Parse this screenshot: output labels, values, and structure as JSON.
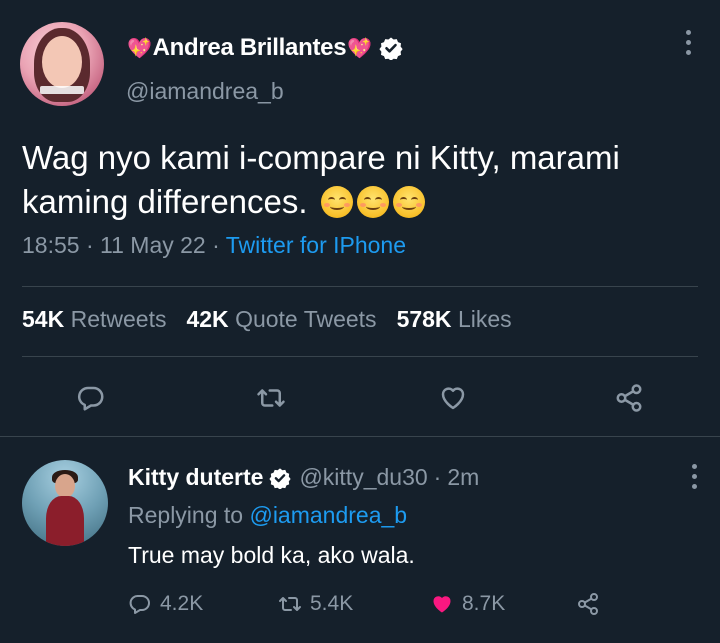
{
  "tweet": {
    "display_name": "Andrea Brillantes",
    "name_emoji_left": "💖",
    "name_emoji_right": "💖",
    "handle": "@iamandrea_b",
    "text": "Wag nyo kami i-compare ni Kitty, marami kaming differences.",
    "emoji": [
      "smiling-face-icon",
      "smiling-face-icon",
      "smiling-face-icon"
    ],
    "time": "18:55",
    "date": "11 May 22",
    "separator": "·",
    "source": "Twitter for IPhone",
    "stats": {
      "retweets_count": "54K",
      "retweets_label": "Retweets",
      "quotes_count": "42K",
      "quotes_label": "Quote Tweets",
      "likes_count": "578K",
      "likes_label": "Likes"
    },
    "actions": [
      "reply-icon",
      "retweet-icon",
      "like-icon",
      "share-icon"
    ]
  },
  "reply": {
    "display_name": "Kitty duterte",
    "handle": "@kitty_du30",
    "separator": "·",
    "time_ago": "2m",
    "replying_prefix": "Replying to",
    "replying_to": "@iamandrea_b",
    "text": "True may bold ka, ako wala.",
    "counts": {
      "replies": "4.2K",
      "retweets": "5.4K",
      "likes": "8.7K"
    }
  },
  "colors": {
    "background": "#15202b",
    "text": "#ffffff",
    "secondary": "#8b98a5",
    "accent": "#1d9bf0",
    "like": "#f91880",
    "divider": "#38444d"
  }
}
